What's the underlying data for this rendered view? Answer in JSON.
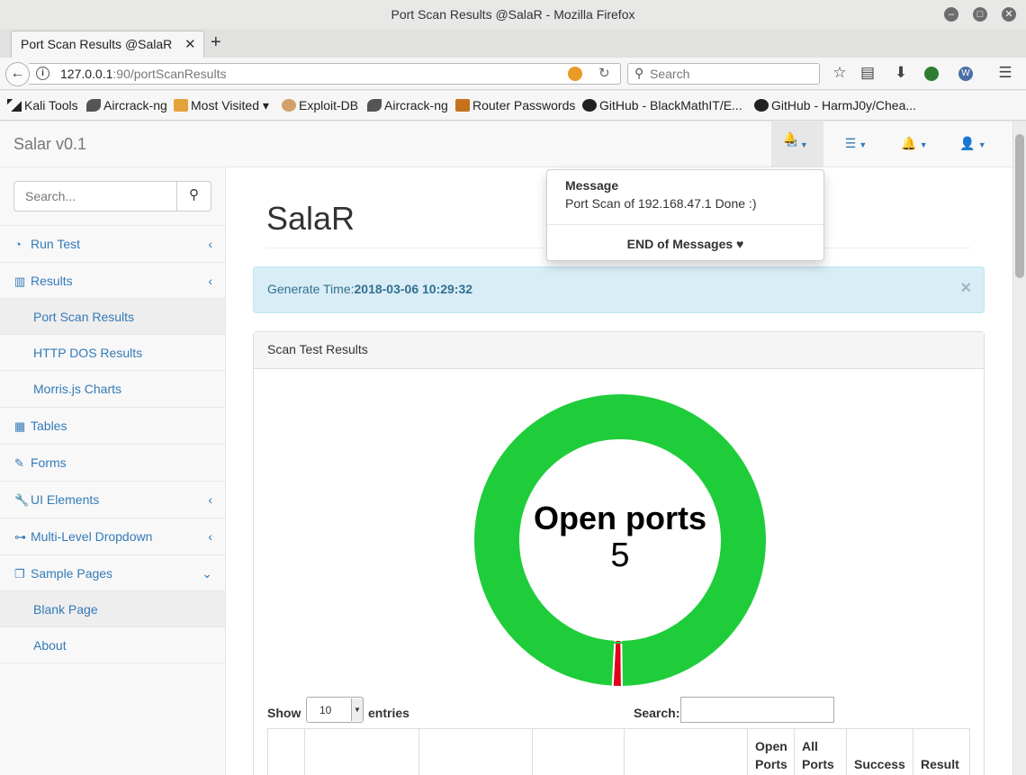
{
  "window": {
    "title": "Port Scan Results @SalaR - Mozilla Firefox"
  },
  "tab": {
    "label": "Port Scan Results @SalaR",
    "close": "✕",
    "new": "+"
  },
  "nav": {
    "url_host": "127.0.0.1",
    "url_rest": ":90/portScanResults",
    "search_placeholder": "Search"
  },
  "bookmarks": [
    "Kali Tools",
    "Aircrack-ng",
    "Most Visited",
    "Exploit-DB",
    "Aircrack-ng",
    "Router Passwords",
    "GitHub - BlackMathIT/E...",
    "GitHub - HarmJ0y/Chea..."
  ],
  "brand": "Salar v0.1",
  "sidebar": {
    "search_placeholder": "Search...",
    "items": [
      {
        "label": "Run Test",
        "icon": "dashboard-icon"
      },
      {
        "label": "Results",
        "icon": "bar-chart-icon"
      },
      {
        "label": "Port Scan Results"
      },
      {
        "label": "HTTP DOS Results"
      },
      {
        "label": "Morris.js Charts"
      },
      {
        "label": "Tables",
        "icon": "table-icon"
      },
      {
        "label": "Forms",
        "icon": "edit-icon"
      },
      {
        "label": "UI Elements",
        "icon": "wrench-icon"
      },
      {
        "label": "Multi-Level Dropdown",
        "icon": "sitemap-icon"
      },
      {
        "label": "Sample Pages",
        "icon": "files-icon"
      },
      {
        "label": "Blank Page"
      },
      {
        "label": "About"
      }
    ]
  },
  "main": {
    "title": "SalaR",
    "alert_label": "Generate Time:",
    "alert_value": "2018-03-06 10:29:32",
    "alert_close": "×",
    "panel_title": "Scan Test Results",
    "donut": {
      "label": "Open ports",
      "value": "5",
      "open": 99,
      "other": 1,
      "colors": {
        "main": "#1fcd3b",
        "accent": "#e0001b"
      }
    },
    "table": {
      "show": "Show",
      "length": "10",
      "entries": "entries",
      "search_label": "Search:",
      "headers": [
        "",
        "",
        "",
        "",
        "",
        "Open Ports",
        "All Ports",
        "Success",
        "Result"
      ]
    }
  },
  "dropdown": {
    "title": "Message",
    "body": "Port Scan of 192.168.47.1 Done :)",
    "end": "END of Messages"
  }
}
